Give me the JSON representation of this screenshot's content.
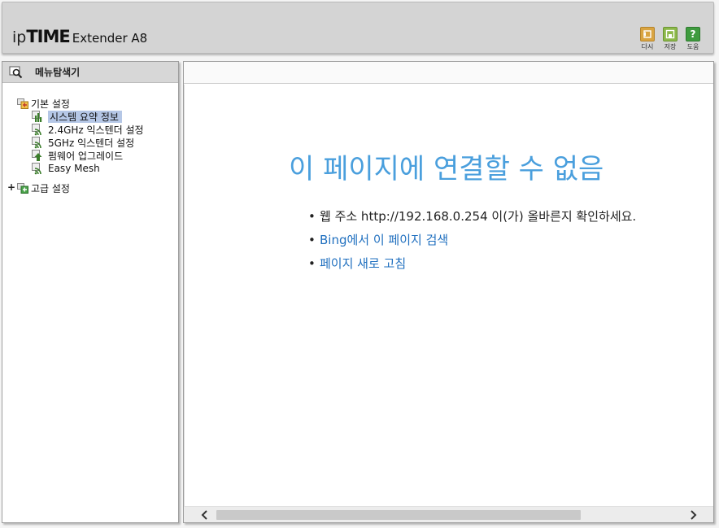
{
  "header": {
    "logo_ip": "ip",
    "logo_time": "TIME",
    "logo_model": "Extender A8",
    "toolbar": [
      {
        "label": "다시",
        "icon": "undo-icon",
        "color": "#d9a441"
      },
      {
        "label": "저장",
        "icon": "save-icon",
        "color": "#8cb84a"
      },
      {
        "label": "도움",
        "icon": "help-icon",
        "color": "#3f9b3f"
      }
    ]
  },
  "sidebar": {
    "title": "메뉴탐색기",
    "basic_group": "기본 설정",
    "items": [
      {
        "label": "시스템 요약 정보",
        "icon": "system-summary-icon"
      },
      {
        "label": "2.4GHz 익스텐더 설정",
        "icon": "wifi-signal-icon"
      },
      {
        "label": "5GHz 익스텐더 설정",
        "icon": "wifi-signal-icon"
      },
      {
        "label": "펌웨어 업그레이드",
        "icon": "firmware-upgrade-icon"
      },
      {
        "label": "Easy Mesh",
        "icon": "wifi-signal-icon"
      }
    ],
    "advanced_expander": "+",
    "advanced_group": "고급 설정"
  },
  "main": {
    "error_title": "이 페이지에 연결할 수 없음",
    "bullets": [
      {
        "text": "웹 주소 http://192.168.0.254 이(가) 올바른지 확인하세요.",
        "link": false
      },
      {
        "text": "Bing에서 이 페이지 검색",
        "link": true
      },
      {
        "text": "페이지 새로 고침",
        "link": true
      }
    ]
  },
  "colors": {
    "error_title": "#4a9fdd",
    "link": "#1f6fbf",
    "selected_row": "#b5c7e6",
    "header_bg": "#d4d4d4"
  }
}
